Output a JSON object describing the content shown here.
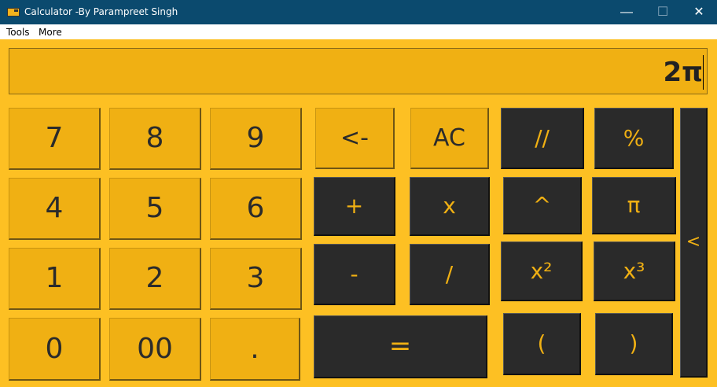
{
  "window": {
    "title": "Calculator -By Parampreet Singh",
    "minimize": "—",
    "maximize": "☐",
    "close": "✕"
  },
  "menu": [
    {
      "label": "Tools"
    },
    {
      "label": "More"
    }
  ],
  "display": {
    "value": "2π"
  },
  "keys": {
    "seven": "7",
    "eight": "8",
    "nine": "9",
    "four": "4",
    "five": "5",
    "six": "6",
    "one": "1",
    "two": "2",
    "three": "3",
    "zero": "0",
    "double_zero": "00",
    "dot": ".",
    "backspace": "<-",
    "clear": "AC",
    "floor_div": "//",
    "percent": "%",
    "plus": "+",
    "times": "x",
    "power": "^",
    "pi": "π",
    "minus": "-",
    "divide": "/",
    "square": "x²",
    "cube": "x³",
    "equals": "=",
    "open_paren": "(",
    "close_paren": ")",
    "collapse": "<"
  },
  "colors": {
    "accent": "#f0b013",
    "dark": "#2a2a2a",
    "background": "#fdc023",
    "titlebar": "#0b4a6e"
  }
}
